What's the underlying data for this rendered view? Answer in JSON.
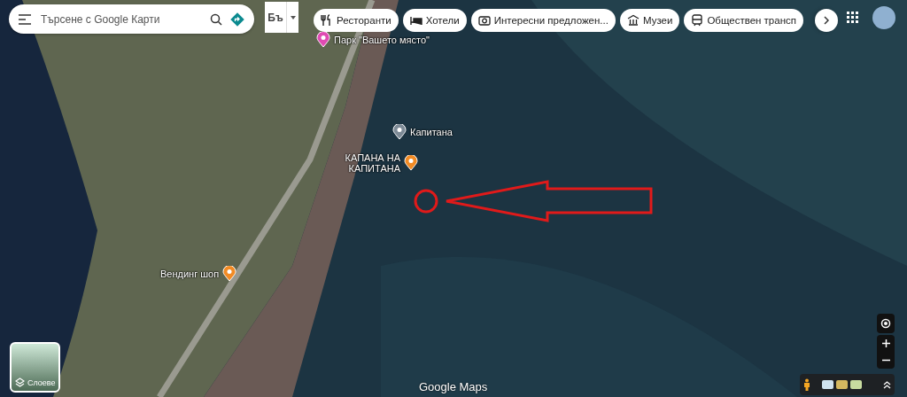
{
  "search": {
    "placeholder": "Търсене с Google Карти"
  },
  "input_tool": {
    "label": "Бъ"
  },
  "chips": [
    {
      "label": "Ресторанти",
      "kind": "restaurant"
    },
    {
      "label": "Хотели",
      "kind": "hotel"
    },
    {
      "label": "Интересни предложен...",
      "kind": "camera"
    },
    {
      "label": "Музеи",
      "kind": "museum"
    },
    {
      "label": "Обществен трансп",
      "kind": "transit"
    }
  ],
  "places": [
    {
      "name": "Парк \"Вашето място\"",
      "kind": "hotel"
    },
    {
      "name": "Капитана",
      "kind": "generic"
    },
    {
      "name": "КАПАНА НА КАПИТАНА",
      "kind": "restaurant"
    },
    {
      "name": "Вендинг шоп",
      "kind": "shop"
    }
  ],
  "layers": {
    "label": "Слоеве"
  },
  "logo": "Google Maps"
}
